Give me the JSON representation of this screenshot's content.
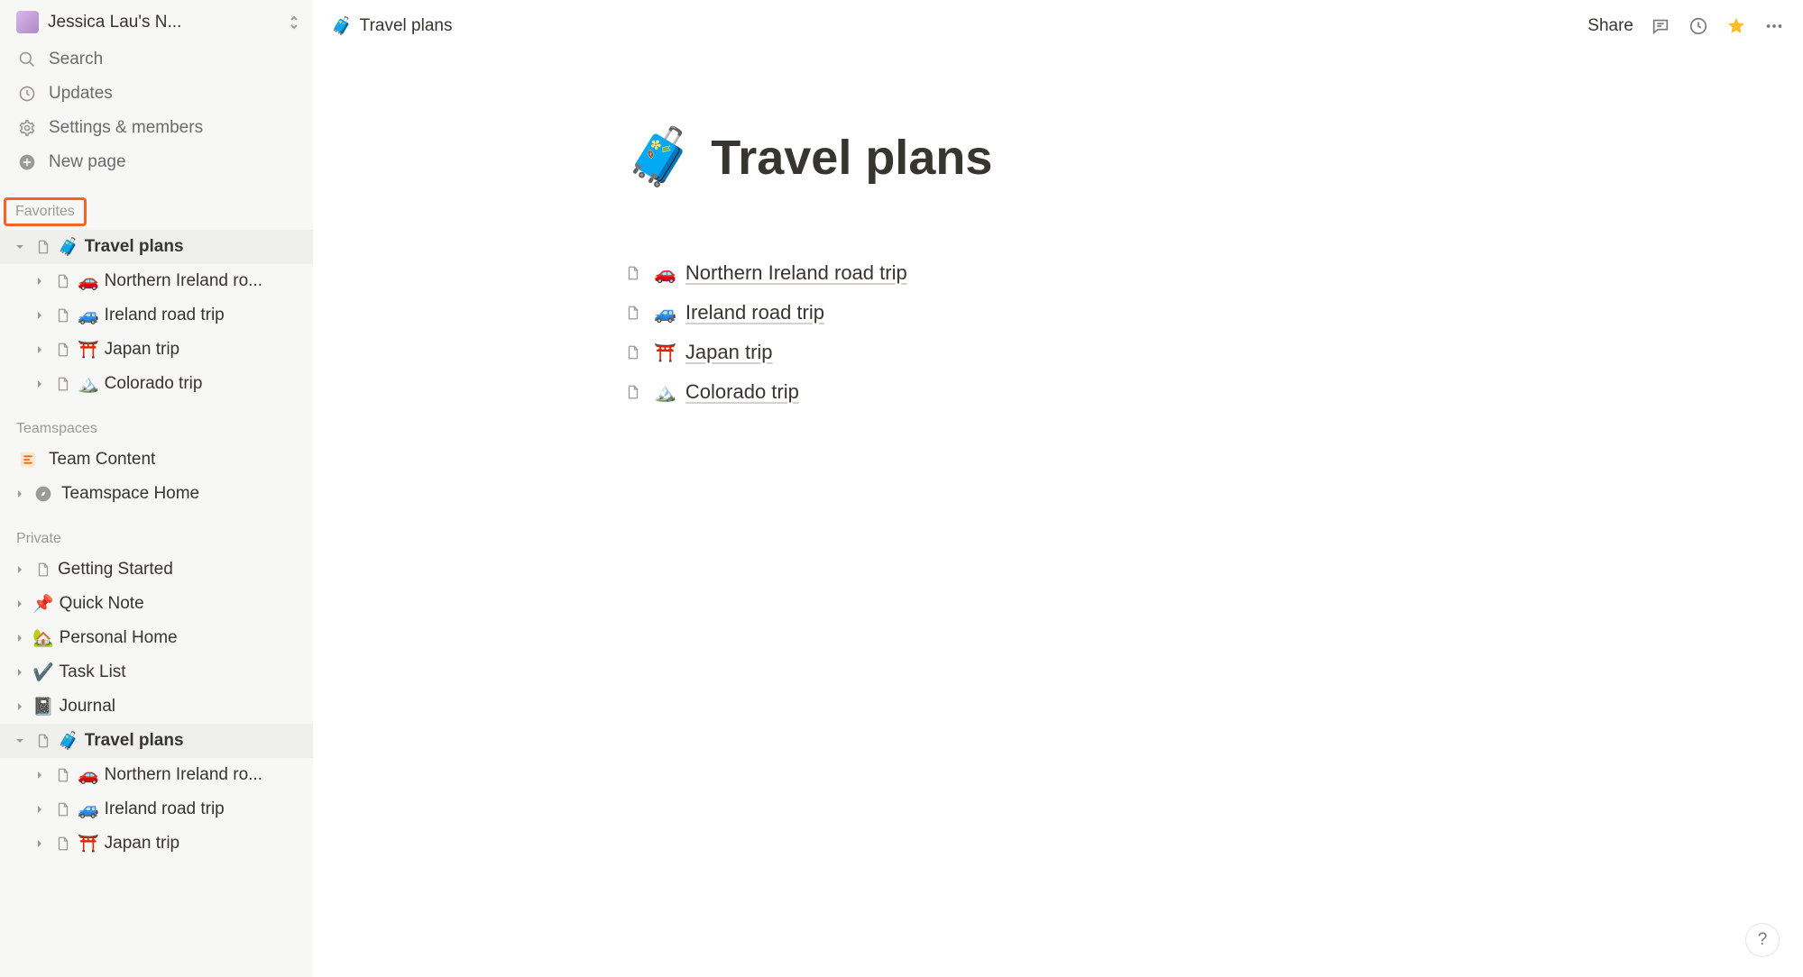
{
  "workspace": {
    "name": "Jessica Lau's N..."
  },
  "nav": {
    "search": "Search",
    "updates": "Updates",
    "settings": "Settings & members",
    "newpage": "New page"
  },
  "sections": {
    "favorites": "Favorites",
    "teamspaces": "Teamspaces",
    "private": "Private"
  },
  "favorites": {
    "root": {
      "emoji": "🧳",
      "label": "Travel plans"
    },
    "children": [
      {
        "emoji": "🚗",
        "label": "Northern Ireland ro..."
      },
      {
        "emoji": "🚙",
        "label": "Ireland road trip"
      },
      {
        "emoji": "⛩️",
        "label": "Japan trip"
      },
      {
        "emoji": "🏔️",
        "label": "Colorado trip"
      }
    ]
  },
  "teamspaces": {
    "items": [
      {
        "emoji": "📝",
        "label": "Team Content",
        "icon": "doc"
      },
      {
        "emoji": "🧭",
        "label": "Teamspace Home",
        "icon": "compass"
      }
    ]
  },
  "private_pages": [
    {
      "emoji": "",
      "label": "Getting Started",
      "expanded": false,
      "depth": 0,
      "pageicon": true
    },
    {
      "emoji": "📌",
      "label": "Quick Note",
      "expanded": false,
      "depth": 0
    },
    {
      "emoji": "🏡",
      "label": "Personal Home",
      "expanded": false,
      "depth": 0
    },
    {
      "emoji": "✔️",
      "label": "Task List",
      "expanded": false,
      "depth": 0
    },
    {
      "emoji": "📓",
      "label": "Journal",
      "expanded": false,
      "depth": 0
    },
    {
      "emoji": "🧳",
      "label": "Travel plans",
      "expanded": true,
      "depth": 0,
      "pageicon": true,
      "active": true
    },
    {
      "emoji": "🚗",
      "label": "Northern Ireland ro...",
      "expanded": false,
      "depth": 1,
      "pageicon": true
    },
    {
      "emoji": "🚙",
      "label": "Ireland road trip",
      "expanded": false,
      "depth": 1,
      "pageicon": true
    },
    {
      "emoji": "⛩️",
      "label": "Japan trip",
      "expanded": false,
      "depth": 1,
      "pageicon": true
    }
  ],
  "breadcrumb": {
    "emoji": "🧳",
    "title": "Travel plans"
  },
  "topbar": {
    "share": "Share"
  },
  "page": {
    "emoji": "🧳",
    "title": "Travel plans",
    "links": [
      {
        "emoji": "🚗",
        "label": "Northern Ireland road trip"
      },
      {
        "emoji": "🚙",
        "label": "Ireland road trip"
      },
      {
        "emoji": "⛩️",
        "label": "Japan trip"
      },
      {
        "emoji": "🏔️",
        "label": "Colorado trip"
      }
    ]
  },
  "help": "?"
}
